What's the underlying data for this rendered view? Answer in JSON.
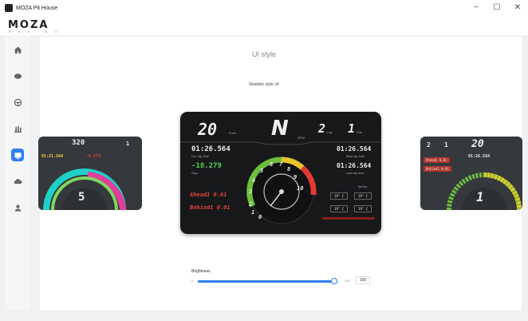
{
  "window": {
    "title": "MOZA Pit House",
    "minimize": "−",
    "maximize": "☐",
    "close": "✕"
  },
  "brand": {
    "logo": "MOZA",
    "sub": "R A C I N G"
  },
  "sidebar": {
    "items": [
      {
        "icon": "home-icon"
      },
      {
        "icon": "wheelbase-icon"
      },
      {
        "icon": "steering-wheel-icon"
      },
      {
        "icon": "pedals-icon"
      },
      {
        "icon": "dashboard-icon",
        "active": true
      },
      {
        "icon": "cloud-icon"
      },
      {
        "icon": "user-icon"
      }
    ]
  },
  "page": {
    "section_title": "UI style",
    "style_name": "Realistic style v4"
  },
  "dash_left": {
    "speed": "320",
    "gear": "5",
    "laptime": "01:21.564",
    "delta": "-0.273",
    "pos": "1"
  },
  "dash_main": {
    "speed": "20",
    "speed_unit": "Km/h",
    "gear": "N",
    "gear_sub": "RPM",
    "lap": "2",
    "lap_unit": "Lap",
    "pos": "1",
    "pos_unit": "Pos",
    "lt1": "01:26.564",
    "lt1_label": "Est. lap time",
    "lt2": "01:26.564",
    "lt2_label": "Best lap time",
    "delta": "-18.279",
    "delta_label": "Gap",
    "lt3": "01:26.564",
    "lt3_label": "Last lap time",
    "ahead": "Ahead1  0.01",
    "behind": "Behind1  0.01",
    "tyre_label": "Tyre(s)",
    "tyres": [
      "19° C",
      "19° C",
      "19° C",
      "19° C"
    ],
    "rpm_labels": [
      "0",
      "1",
      "2",
      "3",
      "4",
      "5",
      "6",
      "7",
      "8",
      "9",
      "10"
    ]
  },
  "dash_right": {
    "speed": "20",
    "gear": "1",
    "lap": "2",
    "time": "01:26.564",
    "ahead": "Ahead1  0.01",
    "behind": "Behind1  0.01"
  },
  "brightness": {
    "label": "Brightness",
    "min": "0",
    "max": "100",
    "value": "100",
    "level_pct": 97
  },
  "colors": {
    "accent": "#2f7ef5",
    "delta_green": "#4fd34a",
    "ahead_red": "#e0423b"
  }
}
